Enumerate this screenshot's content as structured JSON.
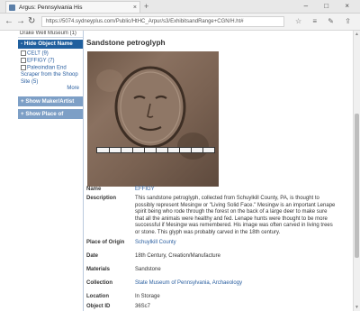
{
  "browser": {
    "tab_title": "Argus: Pennsylvania His",
    "tab_close": "×",
    "new_tab": "+",
    "window_controls": "–  □  ×",
    "back": "←",
    "forward": "→",
    "refresh": "↻",
    "address": "https://5074.sydneyplus.com/Public/HtHC_Arpur/s3/ExhibitsandRange+CGN/H.ht#",
    "toolbar_icons": "☆ ≡ ✎ ⇪ ···"
  },
  "sidebar": {
    "top_item": "Drake Well Museum (1)",
    "facet_open": {
      "label": "- Hide Object Name",
      "items": [
        "CELT (9)",
        "EFFIGY (7)",
        "Paleoindian End Scraper from the Shoop Site (5)"
      ],
      "more": "More"
    },
    "facet_closed": [
      "+ Show Maker/Artist",
      "+ Show Place of Origin"
    ]
  },
  "record": {
    "title": "Sandstone petroglyph",
    "fields": [
      {
        "label": "Name",
        "value": "EFFIGY",
        "link": true
      },
      {
        "label": "Description",
        "value": "This sandstone petroglyph, collected from Schuylkill County, PA, is thought to possibly represent Mesingw or \"Living Solid Face.\" Mesingw is an important Lenape spirit being who rode through the forest on the back of a large deer to make sure that all the animals were healthy and fed. Lenape hunts were thought to be more successful if Mesingw was remembered. His image was often carved in living trees or stone. This glyph was probably carved in the 18th century.",
        "link": false
      },
      {
        "label": "Place of Origin",
        "value": "Schuylkill County",
        "link": true
      },
      {
        "label": "Date",
        "value": "18th Century, Creation/Manufacture",
        "link": false
      },
      {
        "label": "Materials",
        "value": "Sandstone",
        "link": false
      },
      {
        "label": "Collection",
        "value": "State Museum of Pennsylvania, Archaeology",
        "link": true
      },
      {
        "label": "Location",
        "value": "In Storage",
        "link": false
      },
      {
        "label": "Object ID",
        "value": "36Sc7",
        "link": false
      }
    ]
  }
}
